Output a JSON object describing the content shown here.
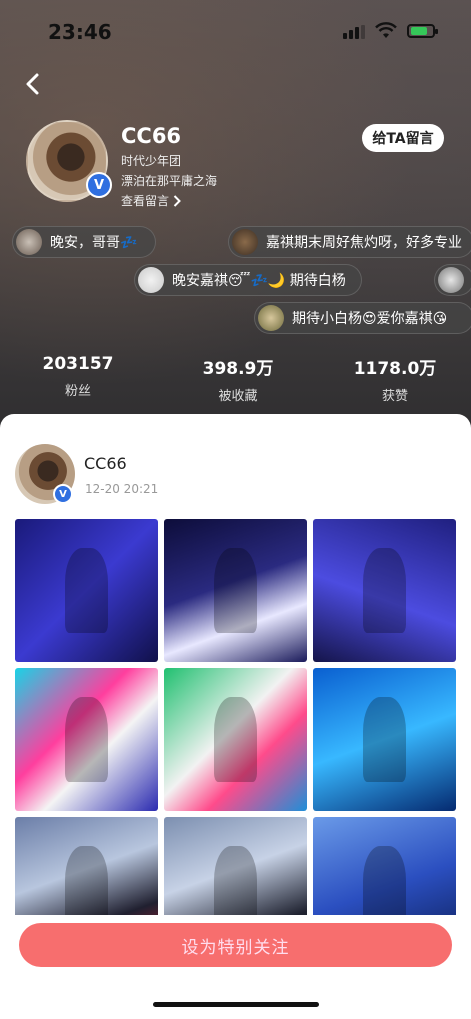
{
  "status_bar": {
    "time": "23:46"
  },
  "profile": {
    "username": "CC66",
    "bio_line1": "时代少年团",
    "bio_line2": "漂泊在那平庸之海",
    "view_messages": "查看留言",
    "leave_message_button": "给TA留言",
    "verified_badge": "V"
  },
  "bubbles": [
    {
      "text": "晚安，哥哥💤"
    },
    {
      "text": "嘉祺期末周好焦灼呀，好多专业"
    },
    {
      "text": "晚安嘉祺😴💤🌙 期待白杨"
    },
    {
      "text": ""
    },
    {
      "text": "期待小白杨😍爱你嘉祺😘"
    }
  ],
  "stats": [
    {
      "value": "203157",
      "label": "粉丝"
    },
    {
      "value": "398.9万",
      "label": "被收藏"
    },
    {
      "value": "1178.0万",
      "label": "获赞"
    }
  ],
  "post": {
    "username": "CC66",
    "time": "12-20 20:21",
    "photo_count": 9
  },
  "follow_button": "设为特别关注",
  "colors": {
    "accent": "#f76e6e",
    "verified": "#2f6fe0"
  }
}
